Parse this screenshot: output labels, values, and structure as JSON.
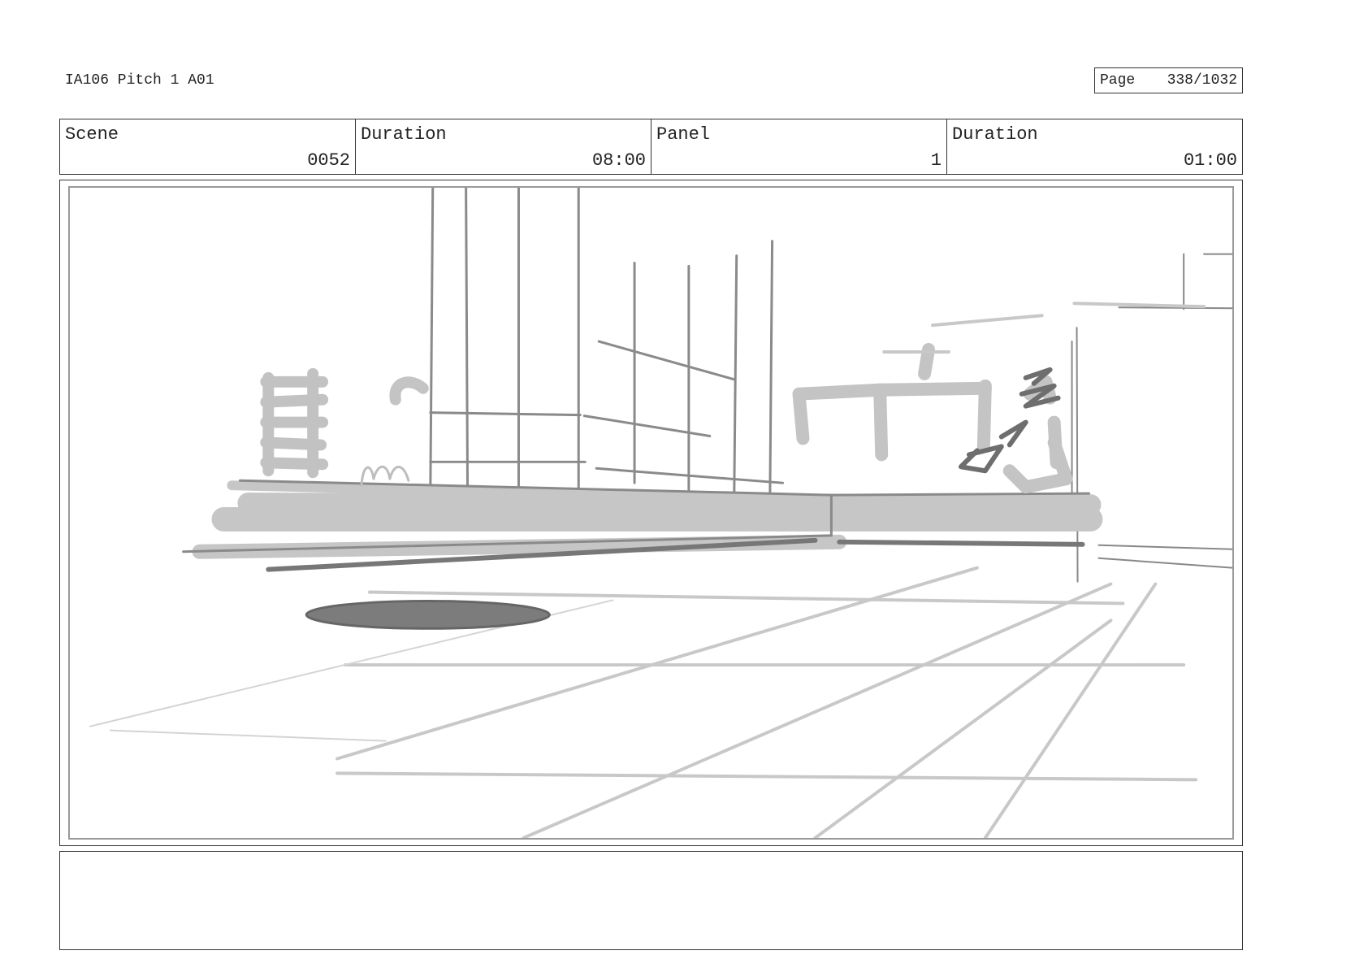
{
  "header": {
    "project_title": "IA106 Pitch 1 A01",
    "page_label": "Page",
    "page_value": "338/1032"
  },
  "info": {
    "scene_label": "Scene",
    "scene_value": "0052",
    "scene_duration_label": "Duration",
    "scene_duration_value": "08:00",
    "panel_label": "Panel",
    "panel_value": "1",
    "panel_duration_label": "Duration",
    "panel_duration_value": "01:00"
  },
  "notes": {
    "text": ""
  }
}
